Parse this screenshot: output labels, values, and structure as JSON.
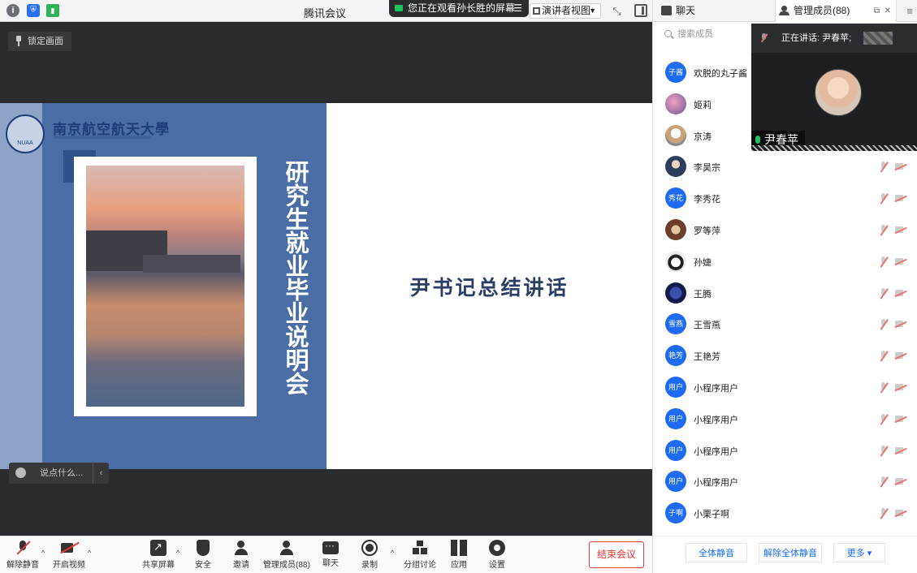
{
  "app": {
    "title": "腾讯会议"
  },
  "topbar": {
    "viewing_banner": "您正在观看孙长胜的屏幕",
    "view_mode": "演讲者视图",
    "info_icon_glyph": "i",
    "shield_icon_glyph": "⛨",
    "signal_icon_glyph": "▮",
    "menu_glyph": "☰",
    "dropdown_glyph": "▼",
    "fullscreen_glyph": "⤡"
  },
  "stage": {
    "lock_label": "锁定画面",
    "chat_placeholder": "说点什么...",
    "collapse_glyph": "‹"
  },
  "slide": {
    "university_name": "南京航空航天大學",
    "vertical_title": "研究生就业毕业说明会",
    "main_title": "尹书记总结讲话"
  },
  "toolbar": {
    "unmute": "解除静音",
    "start_video": "开启视频",
    "share_screen": "共享屏幕",
    "security": "安全",
    "invite": "邀请",
    "manage_members": "管理成员(88)",
    "chat": "聊天",
    "record": "录制",
    "breakout": "分组讨论",
    "apps": "应用",
    "settings": "设置",
    "end_meeting": "结束会议",
    "caret_glyph": "^"
  },
  "panel": {
    "tab_chat": "聊天",
    "tab_members": "管理成员(88)",
    "popout_glyph": "⧉",
    "close_glyph": "✕",
    "menu_glyph": "≡",
    "search_placeholder": "搜索成员",
    "speaking_label": "正在讲话: 尹春苹;",
    "speaker_name": "尹春苹",
    "members": [
      {
        "name": "欢脱的丸子酱",
        "avatar_text": "子酱",
        "avatar_class": "",
        "show_icons": false
      },
      {
        "name": "姬莉",
        "avatar_text": "",
        "avatar_class": "av-img1",
        "show_icons": false
      },
      {
        "name": "京涛",
        "avatar_text": "",
        "avatar_class": "av-img2",
        "show_icons": false
      },
      {
        "name": "李昊宗",
        "avatar_text": "",
        "avatar_class": "av-img3",
        "show_icons": true
      },
      {
        "name": "李秀花",
        "avatar_text": "秀花",
        "avatar_class": "",
        "show_icons": true
      },
      {
        "name": "罗等萍",
        "avatar_text": "",
        "avatar_class": "av-img4",
        "show_icons": true
      },
      {
        "name": "孙婕",
        "avatar_text": "",
        "avatar_class": "av-img5",
        "show_icons": true
      },
      {
        "name": "王腾",
        "avatar_text": "",
        "avatar_class": "av-img6",
        "show_icons": true
      },
      {
        "name": "王雪燕",
        "avatar_text": "雪燕",
        "avatar_class": "",
        "show_icons": true
      },
      {
        "name": "王艳芳",
        "avatar_text": "艳芳",
        "avatar_class": "",
        "show_icons": true
      },
      {
        "name": "小程序用户",
        "avatar_text": "用户",
        "avatar_class": "",
        "show_icons": true
      },
      {
        "name": "小程序用户",
        "avatar_text": "用户",
        "avatar_class": "",
        "show_icons": true
      },
      {
        "name": "小程序用户",
        "avatar_text": "用户",
        "avatar_class": "",
        "show_icons": true
      },
      {
        "name": "小程序用户",
        "avatar_text": "用户",
        "avatar_class": "",
        "show_icons": true
      },
      {
        "name": "小栗子啊",
        "avatar_text": "子啊",
        "avatar_class": "",
        "show_icons": true
      }
    ],
    "mute_all": "全体静音",
    "unmute_all": "解除全体静音",
    "more": "更多 ▾"
  },
  "colors": {
    "accent": "#1d6bf2",
    "danger": "#e53935",
    "slide_blue": "#4a6da5"
  }
}
